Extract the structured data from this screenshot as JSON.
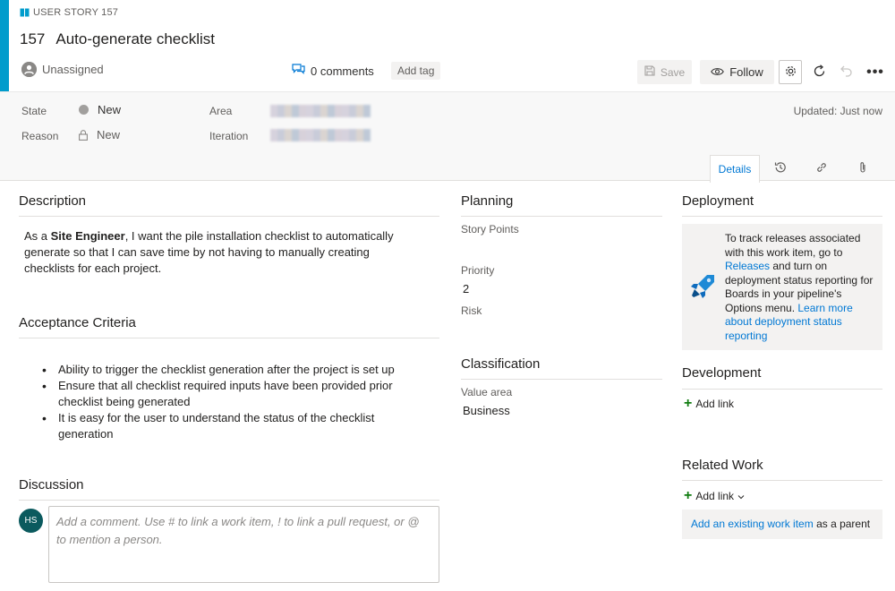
{
  "header": {
    "work_item_type": "USER STORY 157",
    "id": "157",
    "title": "Auto-generate checklist",
    "assignee": "Unassigned",
    "comments_label": "0 comments",
    "add_tag_label": "Add tag",
    "save_label": "Save",
    "follow_label": "Follow",
    "more_label": "•••"
  },
  "meta": {
    "state_label": "State",
    "state_value": "New",
    "reason_label": "Reason",
    "reason_value": "New",
    "area_label": "Area",
    "iteration_label": "Iteration",
    "updated": "Updated: Just now"
  },
  "tabs": {
    "details_label": "Details",
    "icons": [
      "history-icon",
      "links-icon",
      "attachment-icon"
    ]
  },
  "description": {
    "title": "Description",
    "prefix": "As a ",
    "bold": "Site Engineer",
    "rest": ", I want the pile installation checklist to automatically generate so that I can save time by not having to manually creating checklists for each project."
  },
  "acceptance": {
    "title": "Acceptance Criteria",
    "items": [
      "Ability to trigger the checklist generation after the project is set up",
      "Ensure that all checklist required inputs have been provided prior checklist being generated",
      "It is easy for the user to understand the status of the checklist generation"
    ]
  },
  "discussion": {
    "title": "Discussion",
    "avatar_initials": "HS",
    "placeholder": "Add a comment. Use # to link a work item, ! to link a pull request, or @ to mention a person."
  },
  "planning": {
    "title": "Planning",
    "story_points_label": "Story Points",
    "priority_label": "Priority",
    "priority_value": "2",
    "risk_label": "Risk"
  },
  "classification": {
    "title": "Classification",
    "value_area_label": "Value area",
    "value_area_value": "Business"
  },
  "deployment": {
    "title": "Deployment",
    "text_1": "To track releases associated with this work item, go to ",
    "releases_link": "Releases",
    "text_2": " and turn on deployment status reporting for Boards in your pipeline's Options menu. ",
    "learn_more_link": "Learn more about deployment status reporting"
  },
  "development": {
    "title": "Development",
    "add_link_label": "Add link"
  },
  "related_work": {
    "title": "Related Work",
    "add_link_label": "Add link",
    "existing_link": "Add an existing work item",
    "existing_suffix": " as a parent"
  },
  "colors": {
    "accent": "#009ccc",
    "link": "#0078d4",
    "avatar": "#0b5a5e",
    "plus": "#107c10"
  }
}
